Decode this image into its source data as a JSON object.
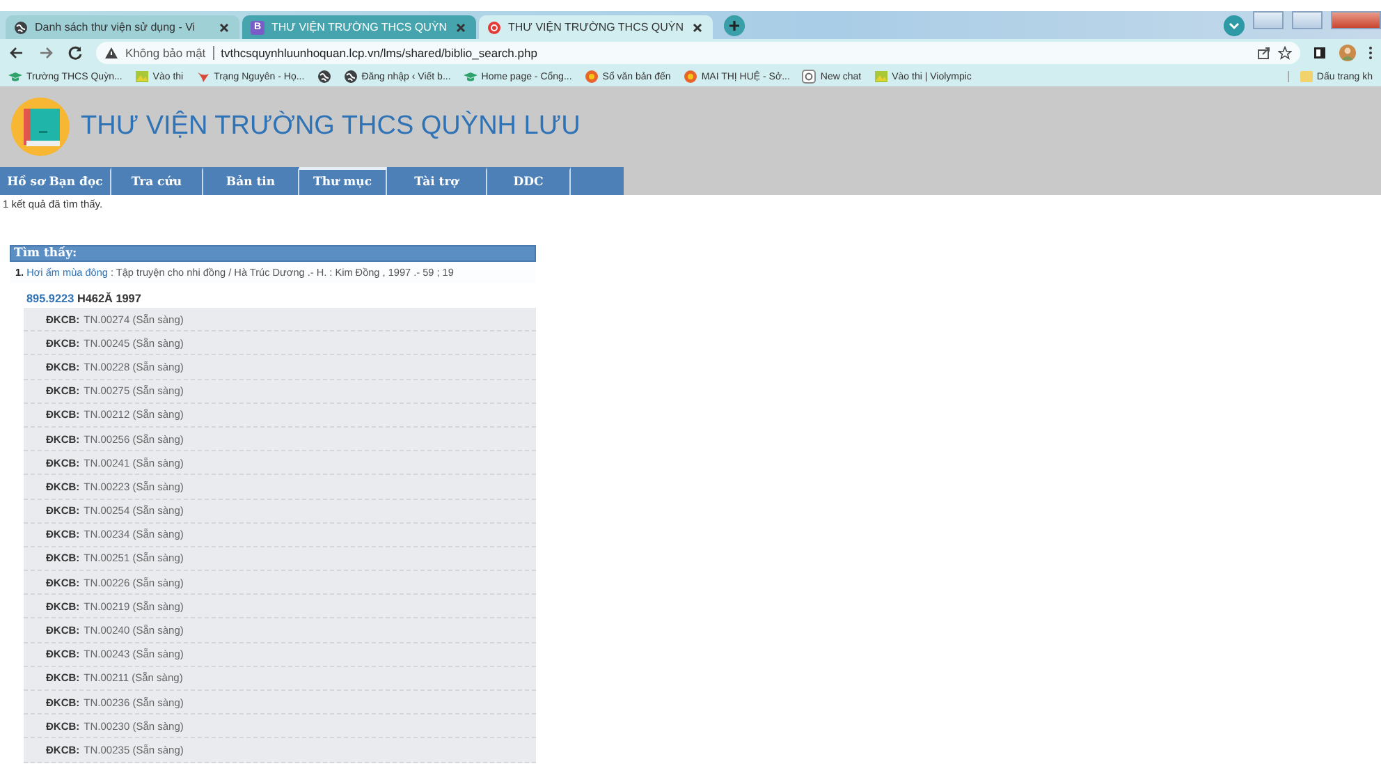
{
  "browser": {
    "tabs": [
      {
        "title": "Danh sách thư viện sử dụng - Vi",
        "kind": "globe",
        "selected": false
      },
      {
        "title": "THƯ VIỆN TRƯỜNG THCS QUỲN",
        "kind": "letter",
        "glyph": "B",
        "selected": false
      },
      {
        "title": "THƯ VIỆN TRƯỜNG THCS QUỲN",
        "kind": "red",
        "selected": true
      }
    ],
    "address": {
      "security": "Không bảo mật",
      "url": "tvthcsquynhluunhoquan.lcp.vn/lms/shared/biblio_search.php"
    },
    "bookmarks": [
      {
        "label": "Trường THCS Quỳn...",
        "kind": "cap"
      },
      {
        "label": "Vào thi",
        "kind": "image"
      },
      {
        "label": "Trạng Nguyên - Họ...",
        "kind": "bird"
      },
      {
        "kind": "globe"
      },
      {
        "label": "Đăng nhập ‹ Viết b...",
        "kind": "globe"
      },
      {
        "label": "Home page - Cổng...",
        "kind": "cap"
      },
      {
        "label": "Sổ văn bản đến",
        "kind": "emblem"
      },
      {
        "label": "MAI THỊ HUỆ - Sở...",
        "kind": "emblem"
      },
      {
        "label": "New chat",
        "kind": "chat"
      },
      {
        "label": "Vào thi | Violympic",
        "kind": "image"
      }
    ],
    "other_bookmarks": "Dấu trang kh"
  },
  "site": {
    "title": "THƯ VIỆN TRƯỜNG THCS QUỲNH LƯU",
    "nav": [
      {
        "label": "Hồ sơ Bạn đọc",
        "selected": false
      },
      {
        "label": "Tra cứu",
        "selected": false
      },
      {
        "label": "Bản tin",
        "selected": false
      },
      {
        "label": "Thư mục",
        "selected": true
      },
      {
        "label": "Tài trợ",
        "selected": false
      },
      {
        "label": "DDC",
        "selected": false
      }
    ],
    "result_count": "1 kết quả đã tìm thấy.",
    "results": {
      "heading": "Tìm thấy:",
      "items": [
        {
          "number": "1.",
          "title": "Hơi ấm mùa đông",
          "details": " : Tập truyện cho nhi đồng / Hà Trúc Dương .- H. : Kim Đồng , 1997 .- 59 ; 19",
          "call_number": "895.9223",
          "call_suffix": "H462Ă 1997",
          "copies": [
            {
              "label": "ĐKCB:",
              "value": "TN.00274 (Sẵn sàng)"
            },
            {
              "label": "ĐKCB:",
              "value": "TN.00245 (Sẵn sàng)"
            },
            {
              "label": "ĐKCB:",
              "value": "TN.00228 (Sẵn sàng)"
            },
            {
              "label": "ĐKCB:",
              "value": "TN.00275 (Sẵn sàng)"
            },
            {
              "label": "ĐKCB:",
              "value": "TN.00212 (Sẵn sàng)"
            },
            {
              "label": "ĐKCB:",
              "value": "TN.00256 (Sẵn sàng)"
            },
            {
              "label": "ĐKCB:",
              "value": "TN.00241 (Sẵn sàng)"
            },
            {
              "label": "ĐKCB:",
              "value": "TN.00223 (Sẵn sàng)"
            },
            {
              "label": "ĐKCB:",
              "value": "TN.00254 (Sẵn sàng)"
            },
            {
              "label": "ĐKCB:",
              "value": "TN.00234 (Sẵn sàng)"
            },
            {
              "label": "ĐKCB:",
              "value": "TN.00251 (Sẵn sàng)"
            },
            {
              "label": "ĐKCB:",
              "value": "TN.00226 (Sẵn sàng)"
            },
            {
              "label": "ĐKCB:",
              "value": "TN.00219 (Sẵn sàng)"
            },
            {
              "label": "ĐKCB:",
              "value": "TN.00240 (Sẵn sàng)"
            },
            {
              "label": "ĐKCB:",
              "value": "TN.00243 (Sẵn sàng)"
            },
            {
              "label": "ĐKCB:",
              "value": "TN.00211 (Sẵn sàng)"
            },
            {
              "label": "ĐKCB:",
              "value": "TN.00236 (Sẵn sàng)"
            },
            {
              "label": "ĐKCB:",
              "value": "TN.00230 (Sẵn sàng)"
            },
            {
              "label": "ĐKCB:",
              "value": "TN.00235 (Sẵn sàng)"
            }
          ]
        }
      ]
    }
  }
}
